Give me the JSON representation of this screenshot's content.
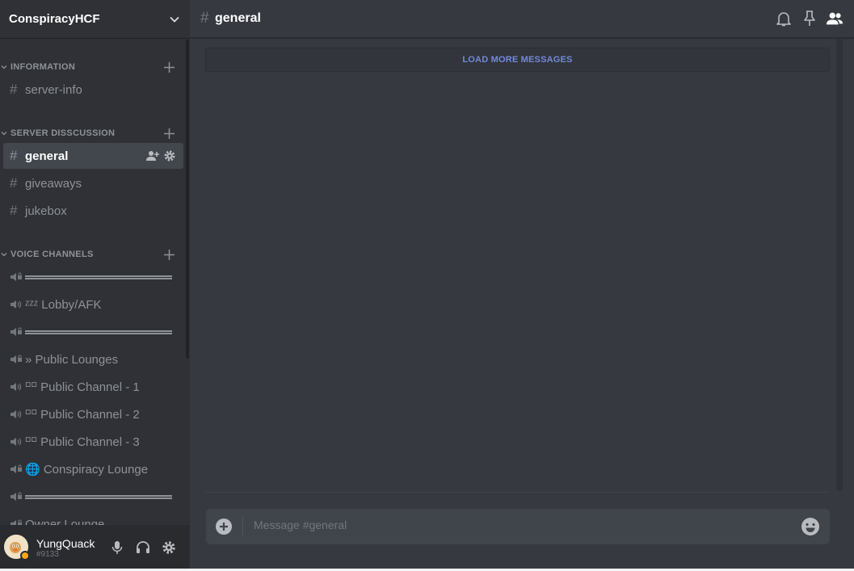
{
  "server": {
    "name": "ConspiracyHCF"
  },
  "categories": [
    {
      "label": "INFORMATION"
    },
    {
      "label": "SERVER DISSCUSSION"
    },
    {
      "label": "VOICE CHANNELS"
    }
  ],
  "text_channels": [
    {
      "hash": "#",
      "name": "server-info"
    },
    {
      "hash": "#",
      "name": "general"
    },
    {
      "hash": "#",
      "name": "giveaways"
    },
    {
      "hash": "#",
      "name": "jukebox"
    }
  ],
  "voice_channels": [
    {
      "name": "",
      "locked": true,
      "divider": true
    },
    {
      "name": "ᶻᶻᶻ Lobby/AFK",
      "locked": false,
      "divider": false
    },
    {
      "name": "",
      "locked": true,
      "divider": true
    },
    {
      "name": "» Public Lounges",
      "locked": true,
      "divider": false
    },
    {
      "name": "⸋⸋ Public Channel - 1",
      "locked": false,
      "divider": false
    },
    {
      "name": "⸋⸋ Public Channel - 2",
      "locked": false,
      "divider": false
    },
    {
      "name": "⸋⸋ Public Channel - 3",
      "locked": false,
      "divider": false
    },
    {
      "name": "🌐 Conspiracy Lounge",
      "locked": true,
      "divider": false
    },
    {
      "name": "",
      "locked": true,
      "divider": true
    },
    {
      "name": "Owner Lounge",
      "locked": true,
      "divider": false
    }
  ],
  "user": {
    "username": "YungQuack",
    "discriminator": "#9133",
    "status_color": "#faa61a"
  },
  "channel_header": {
    "hash": "#",
    "name": "general"
  },
  "messages": {
    "load_more_label": "LOAD MORE MESSAGES"
  },
  "composer": {
    "placeholder": "Message #general"
  },
  "icons": {
    "server_menu": "chevron-down-icon",
    "category_collapse": "chevron-down-icon",
    "category_add": "plus-icon",
    "invite": "add-user-icon",
    "settings": "gear-icon",
    "speaker": "speaker-icon",
    "locked_speaker": "locked-speaker-icon",
    "mic": "microphone-icon",
    "headphones": "headphones-icon",
    "bell": "bell-icon",
    "pin": "pin-icon",
    "members": "members-icon",
    "attach": "plus-circle-icon",
    "emoji": "emoji-icon"
  },
  "colors": {
    "accent": "#7289da",
    "sidebar": "#2f3136",
    "main": "#36393f",
    "user_panel": "#292b2f"
  }
}
